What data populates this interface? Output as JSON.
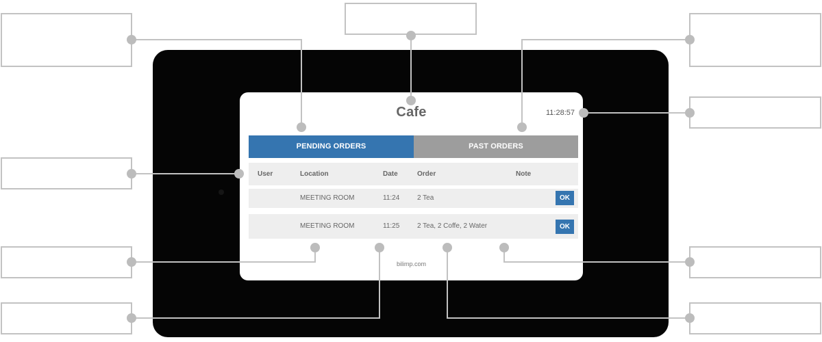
{
  "app": {
    "title": "Cafe",
    "clock": "11:28:57"
  },
  "tabs": [
    {
      "label": "PENDING ORDERS",
      "active": true
    },
    {
      "label": "PAST ORDERS",
      "active": false
    }
  ],
  "table": {
    "headers": {
      "user": "User",
      "location": "Location",
      "date": "Date",
      "order": "Order",
      "note": "Note"
    },
    "rows": [
      {
        "user": "",
        "location": "MEETING ROOM",
        "date": "11:24",
        "order": "2 Tea",
        "note": "",
        "action": "OK"
      },
      {
        "user": "",
        "location": "MEETING ROOM",
        "date": "11:25",
        "order": "2 Tea, 2 Coffe, 2 Water",
        "note": "",
        "action": "OK"
      }
    ]
  },
  "footer": "bilimp.com",
  "colors": {
    "accent": "#3575b0",
    "tab_inactive": "#9d9d9d",
    "row_bg": "#eeeeee",
    "callout_border": "#c2c2c2"
  }
}
